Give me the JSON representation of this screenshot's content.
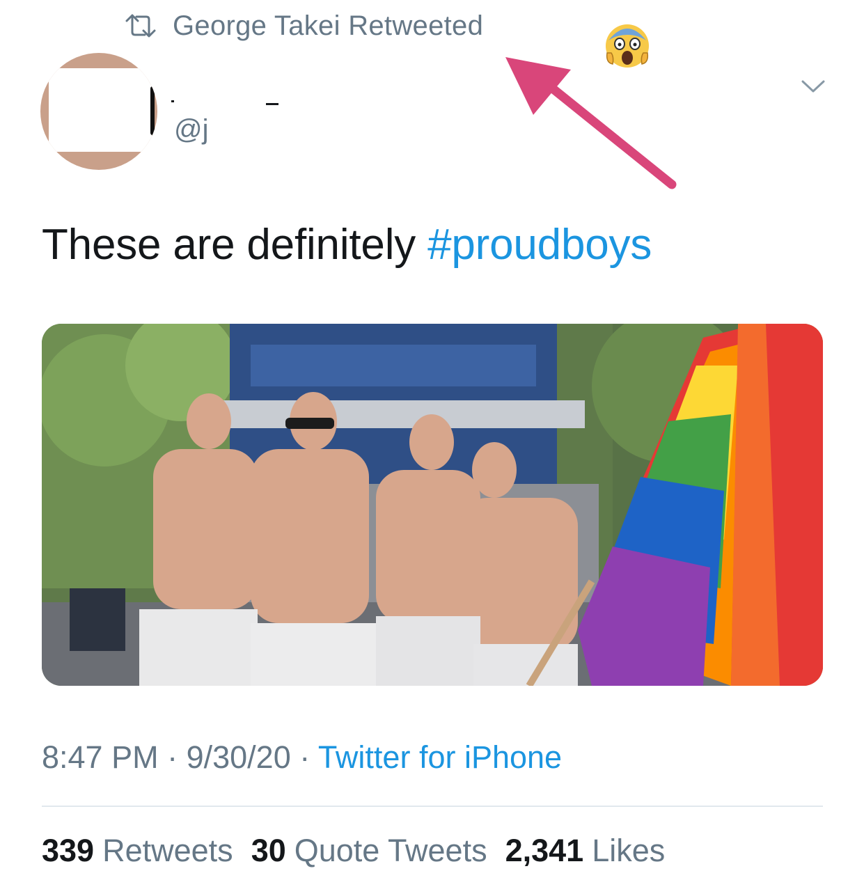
{
  "retweet_banner": {
    "text": "George Takei Retweeted",
    "icon": "retweet-icon"
  },
  "annotations": {
    "emoji": "face-screaming-in-fear",
    "arrow_color": "#d9467a"
  },
  "author": {
    "handle": "@j"
  },
  "tweet": {
    "text": "These are definitely ",
    "hashtag": "#proudboys",
    "photo_alt": "Photo"
  },
  "meta": {
    "time": "8:47 PM",
    "sep1": " · ",
    "date": "9/30/20",
    "sep2": " · ",
    "source": "Twitter for iPhone"
  },
  "stats": {
    "retweets_count": "339",
    "retweets_label": "Retweets",
    "quotes_count": "30",
    "quotes_label": "Quote Tweets",
    "likes_count": "2,341",
    "likes_label": "Likes"
  },
  "colors": {
    "link": "#1b95e0",
    "secondary_text": "#657786",
    "primary_text": "#14171a"
  }
}
